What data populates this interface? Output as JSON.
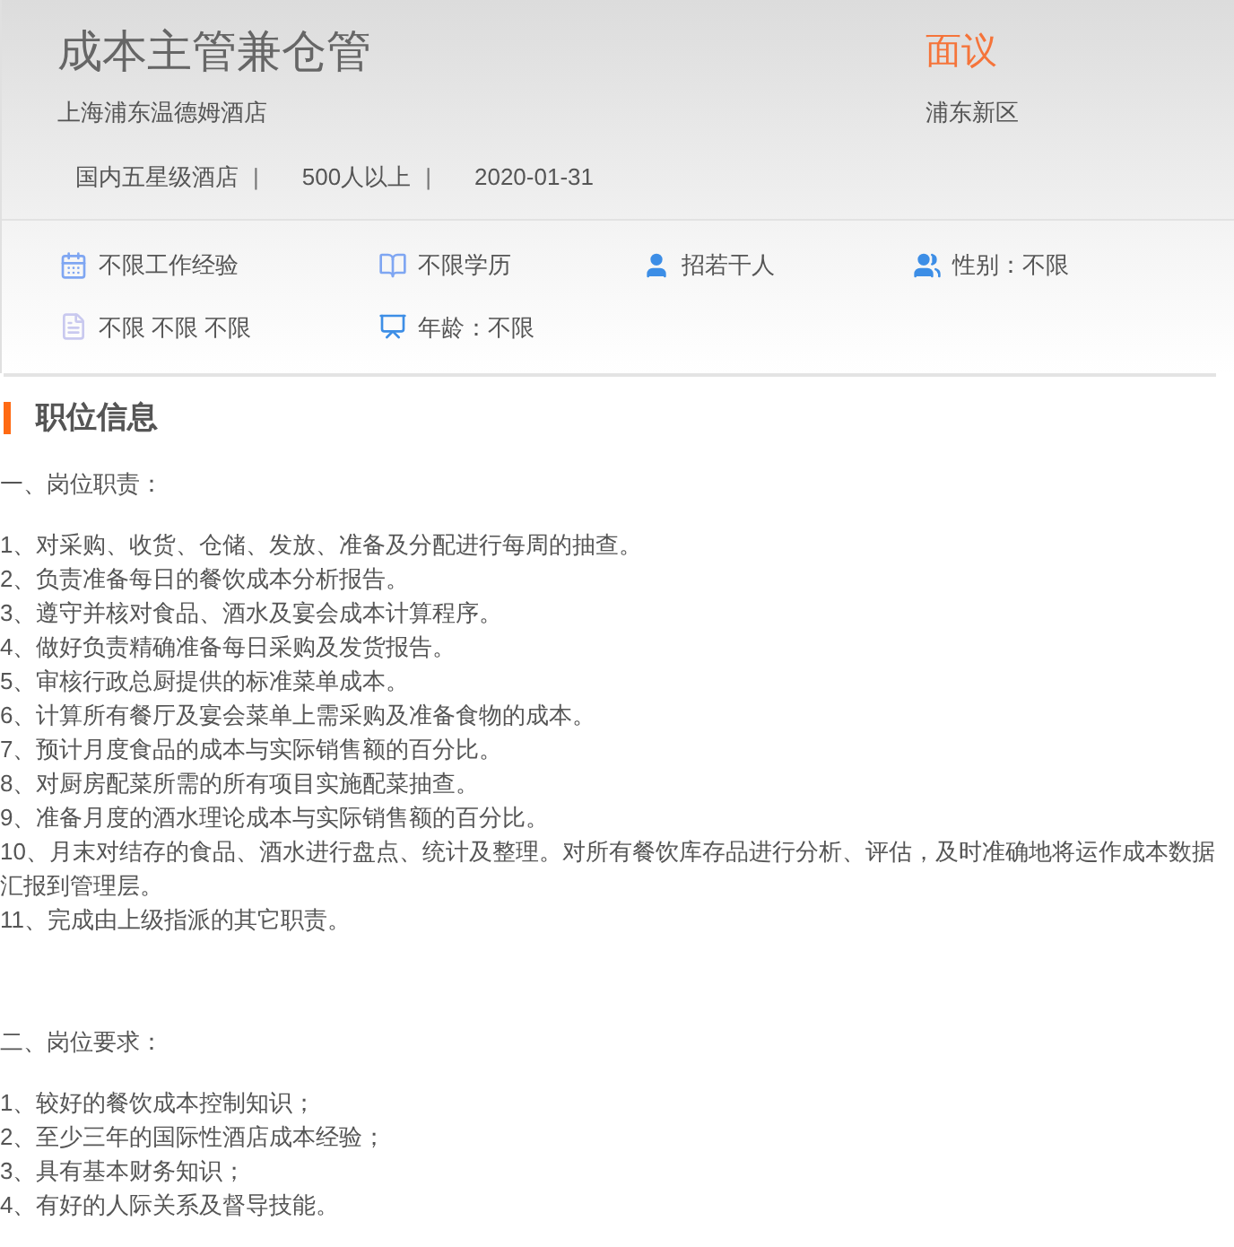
{
  "header": {
    "title": "成本主管兼仓管",
    "salary": "面议",
    "company": "上海浦东温德姆酒店",
    "location": "浦东新区",
    "meta": [
      "国内五星级酒店",
      "500人以上",
      "2020-01-31"
    ],
    "meta_separator": "|"
  },
  "tags": [
    {
      "kind": "experience",
      "text": "不限工作经验"
    },
    {
      "kind": "education",
      "text": "不限学历"
    },
    {
      "kind": "headcount",
      "text": "招若干人"
    },
    {
      "kind": "gender",
      "text": "性别：不限"
    },
    {
      "kind": "language",
      "text": "不限 不限 不限"
    },
    {
      "kind": "age",
      "text": "年龄：不限"
    }
  ],
  "section": {
    "title": "职位信息"
  },
  "blocks": [
    {
      "heading": "一、岗位职责：",
      "items": [
        "1、对采购、收货、仓储、发放、准备及分配进行每周的抽查。",
        "2、负责准备每日的餐饮成本分析报告。",
        "3、遵守并核对食品、酒水及宴会成本计算程序。",
        "4、做好负责精确准备每日采购及发货报告。",
        "5、审核行政总厨提供的标准菜单成本。",
        "6、计算所有餐厅及宴会菜单上需采购及准备食物的成本。",
        "7、预计月度食品的成本与实际销售额的百分比。",
        "8、对厨房配菜所需的所有项目实施配菜抽查。",
        "9、准备月度的酒水理论成本与实际销售额的百分比。",
        "10、月末对结存的食品、酒水进行盘点、统计及整理。对所有餐饮库存品进行分析、评估，及时准确地将运作成本数据汇报到管理层。",
        "11、完成由上级指派的其它职责。"
      ]
    },
    {
      "heading": "二、岗位要求：",
      "items": [
        "1、较好的餐饮成本控制知识；",
        "2、至少三年的国际性酒店成本经验；",
        "3、具有基本财务知识；",
        "4、有好的人际关系及督导技能。"
      ]
    }
  ]
}
